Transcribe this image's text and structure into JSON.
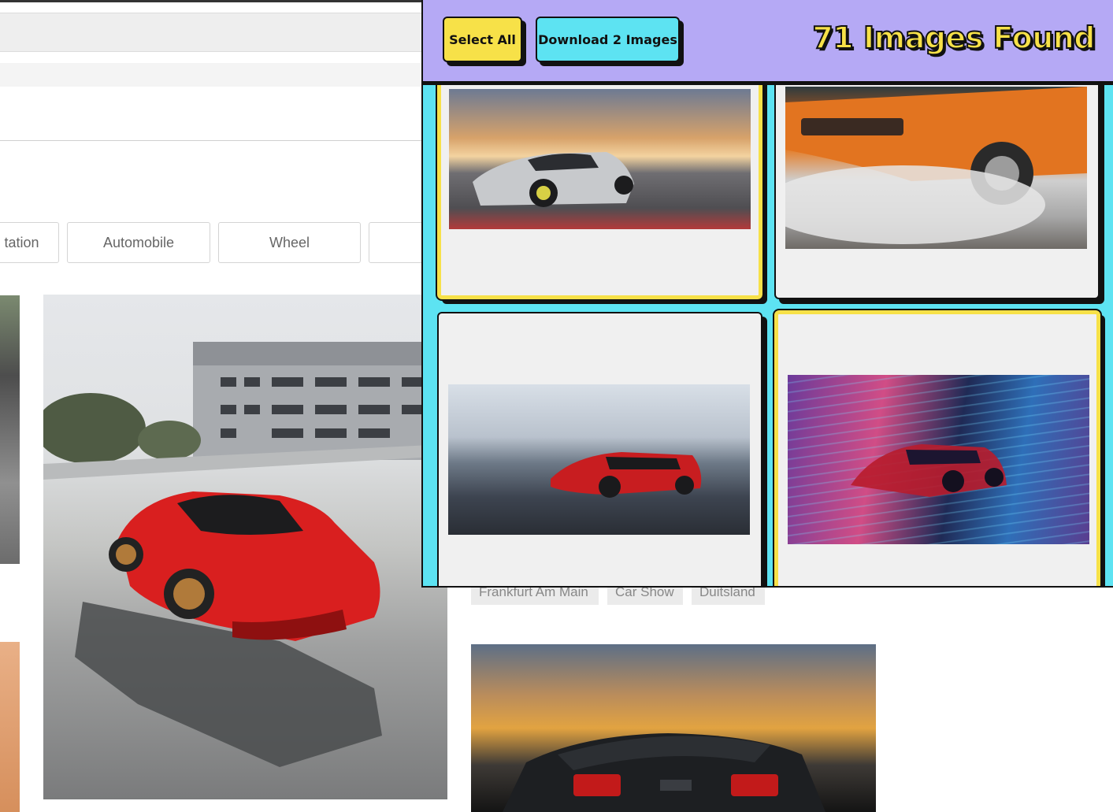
{
  "background_page": {
    "chips": [
      "tation",
      "Automobile",
      "Wheel"
    ],
    "tags": [
      "Frankfurt Am Main",
      "Car Show",
      "Duitsland"
    ],
    "photos": [
      "left-edge-photo",
      "red-ferrari-photo",
      "left-edge-photo-bottom",
      "mustang-sunset-photo"
    ]
  },
  "popup": {
    "select_all_label": "Select All",
    "download_label": "Download 2 Images",
    "found_title": "71 Images Found",
    "colors": {
      "header_bg": "#b5a9f5",
      "grid_bg": "#5de3f2",
      "accent_yellow": "#f7e148",
      "border": "#111111"
    },
    "cards": [
      {
        "selected": true,
        "image": "silver-supercar-sunset"
      },
      {
        "selected": false,
        "image": "orange-muscle-car-burnout"
      },
      {
        "selected": false,
        "image": "red-sports-car-track"
      },
      {
        "selected": true,
        "image": "neon-speed-car"
      }
    ]
  }
}
